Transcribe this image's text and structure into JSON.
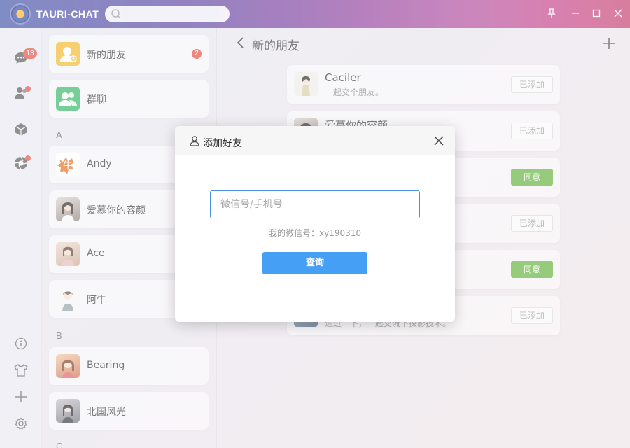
{
  "app": {
    "title": "TAURI-CHAT",
    "search_placeholder": ""
  },
  "window_controls": {
    "pin": "pin-icon",
    "minimize": "minimize-icon",
    "maximize": "maximize-icon",
    "close": "close-icon"
  },
  "iconbar": {
    "chat_badge": "13",
    "top_items": [
      "chat-icon",
      "contacts-icon",
      "cube-icon",
      "aperture-icon"
    ],
    "bottom_items": [
      "info-icon",
      "tshirt-icon",
      "plus-icon",
      "settings-icon"
    ]
  },
  "contacts": {
    "new_friends": {
      "label": "新的朋友",
      "badge": "2"
    },
    "group_chat": {
      "label": "群聊"
    },
    "sections": [
      {
        "letter": "A",
        "items": [
          "Andy",
          "爱慕你的容颜",
          "Ace",
          "阿牛"
        ]
      },
      {
        "letter": "B",
        "items": [
          "Bearing",
          "北国风光"
        ]
      },
      {
        "letter": "C",
        "items": []
      }
    ]
  },
  "main": {
    "title": "新的朋友",
    "friends": [
      {
        "name": "Caciler",
        "message": "一起交个朋友。",
        "action": "已添加"
      },
      {
        "name": "爱慕你的容颜",
        "message": "",
        "action": "已添加"
      },
      {
        "name": "",
        "message": "",
        "action": "同意"
      },
      {
        "name": "",
        "message": "",
        "action": "已添加"
      },
      {
        "name": "",
        "message": "",
        "action": "同意"
      },
      {
        "name": "",
        "message": "通过一下，一起交流下摄影技术。",
        "action": "已添加"
      }
    ]
  },
  "dialog": {
    "title": "添加好友",
    "input_placeholder": "微信号/手机号",
    "hint": "我的微信号：xy190310",
    "query_label": "查询"
  },
  "colors": {
    "accent_blue": "#459ff5",
    "agree_green": "#5eb035",
    "badge_red": "#e5483a"
  }
}
